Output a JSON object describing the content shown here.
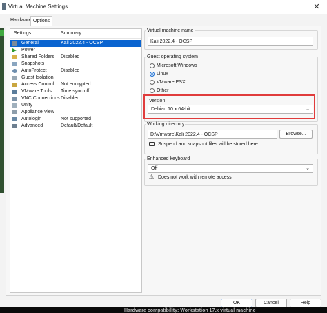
{
  "window": {
    "title": "Virtual Machine Settings"
  },
  "tabs": [
    {
      "label": "Hardware"
    },
    {
      "label": "Options"
    }
  ],
  "list": {
    "headers": {
      "settings": "Settings",
      "summary": "Summary"
    },
    "items": [
      {
        "name": "General",
        "summary": "Kali 2022.4 - OCSP",
        "icon": "general-icon"
      },
      {
        "name": "Power",
        "summary": "",
        "icon": "power-play-icon"
      },
      {
        "name": "Shared Folders",
        "summary": "Disabled",
        "icon": "shared-folders-icon"
      },
      {
        "name": "Snapshots",
        "summary": "",
        "icon": "snapshots-icon"
      },
      {
        "name": "AutoProtect",
        "summary": "Disabled",
        "icon": "autoprotect-icon"
      },
      {
        "name": "Guest Isolation",
        "summary": "",
        "icon": "guest-isolation-icon"
      },
      {
        "name": "Access Control",
        "summary": "Not encrypted",
        "icon": "access-control-icon"
      },
      {
        "name": "VMware Tools",
        "summary": "Time sync off",
        "icon": "vmware-tools-icon"
      },
      {
        "name": "VNC Connections",
        "summary": "Disabled",
        "icon": "vnc-icon"
      },
      {
        "name": "Unity",
        "summary": "",
        "icon": "unity-icon"
      },
      {
        "name": "Appliance View",
        "summary": "",
        "icon": "appliance-view-icon"
      },
      {
        "name": "Autologin",
        "summary": "Not supported",
        "icon": "autologin-icon"
      },
      {
        "name": "Advanced",
        "summary": "Default/Default",
        "icon": "advanced-icon"
      }
    ]
  },
  "vm_name": {
    "label": "Virtual machine name",
    "value": "Kali 2022.4 - OCSP"
  },
  "guest_os": {
    "label": "Guest operating system",
    "options": [
      {
        "label": "Microsoft Windows",
        "selected": false
      },
      {
        "label": "Linux",
        "selected": true
      },
      {
        "label": "VMware ESX",
        "selected": false
      },
      {
        "label": "Other",
        "selected": false
      }
    ]
  },
  "version": {
    "label": "Version:",
    "value": "Debian 10.x 64-bit"
  },
  "working_dir": {
    "label": "Working directory",
    "value": "D:\\Vmware\\Kali 2022.4 - OCSP",
    "browse_label": "Browse...",
    "hint": "Suspend and snapshot files will be stored here."
  },
  "keyboard": {
    "label": "Enhanced keyboard",
    "value": "Off",
    "hint": "Does not work with remote access."
  },
  "buttons": {
    "ok": "OK",
    "cancel": "Cancel",
    "help": "Help"
  },
  "background": {
    "hw_compat": "Hardware compatibility: Workstation 17.x virtual machine"
  },
  "colors": {
    "accent": "#0a64d0",
    "highlight_box": "#e03c3c"
  }
}
